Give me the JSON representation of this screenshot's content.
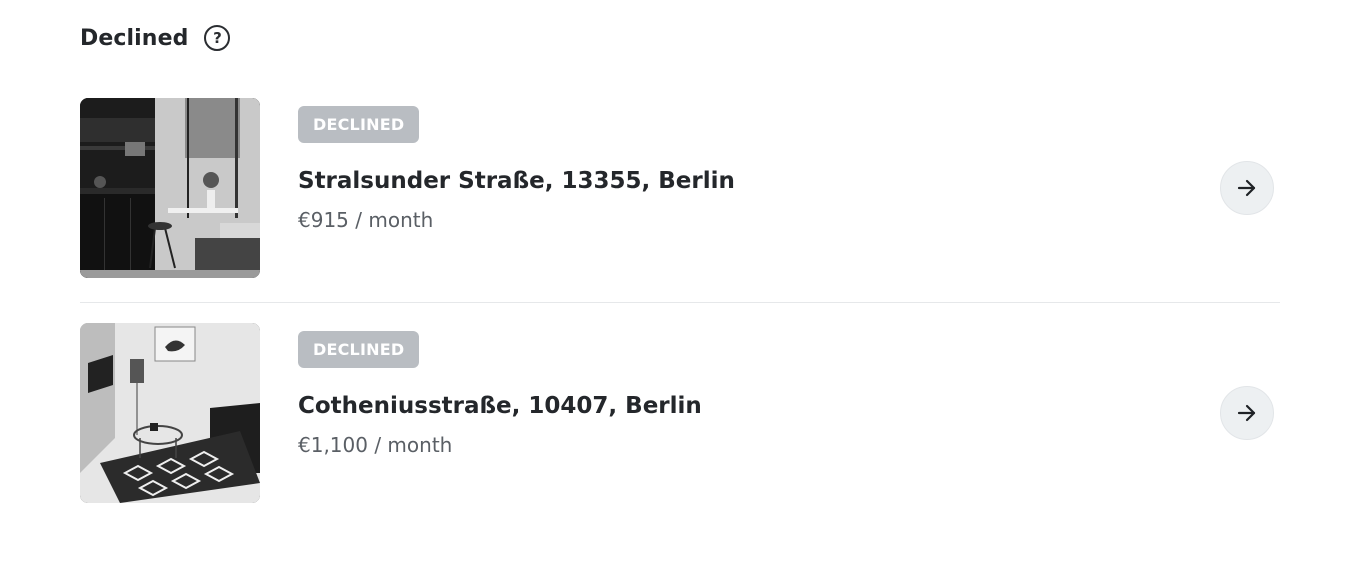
{
  "section": {
    "title": "Declined",
    "help_icon": "question-circle-icon"
  },
  "listings": [
    {
      "status": "DECLINED",
      "address": "Stralsunder Straße, 13355, Berlin",
      "price": "€915 / month",
      "action_icon": "arrow-right-icon"
    },
    {
      "status": "DECLINED",
      "address": "Cotheniusstraße, 10407, Berlin",
      "price": "€1,100 / month",
      "action_icon": "arrow-right-icon"
    }
  ],
  "colors": {
    "badge_background": "#b9bdc2",
    "button_background": "#edf0f2",
    "text_primary": "#24272b",
    "text_secondary": "#5a5f65",
    "divider": "#e6e8ea"
  }
}
